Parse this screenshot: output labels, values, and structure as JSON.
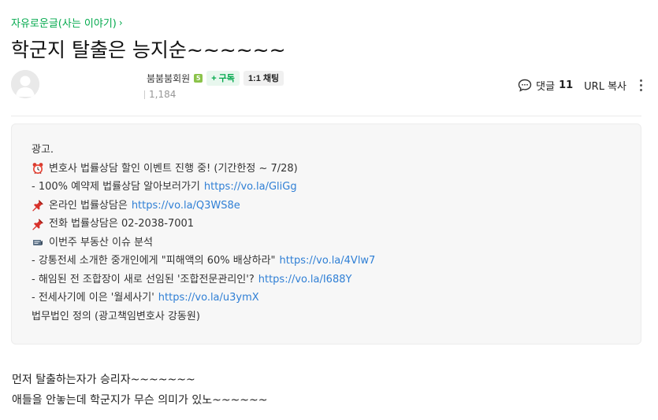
{
  "post": {
    "category": "자유로운글(사는 이야기)",
    "title": "학군지 탈출은 능지순~~~~~~",
    "author": {
      "nickname": "붐붐붐회원",
      "level_badge": "5",
      "subscribe_label": "+ 구독",
      "chat_label": "1:1 채팅",
      "views": "1,184"
    },
    "actions": {
      "comment_label": "댓글",
      "comment_count": "11",
      "url_copy_label": "URL 복사"
    }
  },
  "ad": {
    "lines": [
      {
        "icon": "",
        "text": "광고.",
        "link": ""
      },
      {
        "icon": "alarm-clock-icon",
        "text": "변호사 법률상담 할인 이벤트 진행 중! (기간한정 ~ 7/28)",
        "link": ""
      },
      {
        "icon": "",
        "text": "- 100% 예약제 법률상담 알아보러가기",
        "link": "https://vo.la/GliGg"
      },
      {
        "icon": "pushpin-icon",
        "text": "온라인 법률상담은",
        "link": "https://vo.la/Q3WS8e"
      },
      {
        "icon": "pushpin-icon",
        "text": "전화 법률상담은 02-2038-7001",
        "link": ""
      },
      {
        "icon": "news-icon",
        "text": "이번주 부동산 이슈 분석",
        "link": ""
      },
      {
        "icon": "",
        "text": "- 강통전세 소개한 중개인에게 \"피해액의 60% 배상하라\"",
        "link": "https://vo.la/4Vlw7"
      },
      {
        "icon": "",
        "text": "- 해임된 전 조합장이 새로 선임된 '조합전문관리인'?",
        "link": "https://vo.la/I688Y"
      },
      {
        "icon": "",
        "text": "- 전세사기에 이은 '월세사기'",
        "link": "https://vo.la/u3ymX"
      },
      {
        "icon": "",
        "text": "법무법인 정의 (광고책임변호사 강동원)",
        "link": ""
      }
    ]
  },
  "content": {
    "lines": [
      "먼저 탈출하는자가 승리자~~~~~~~",
      "애들을 안놓는데 학군지가 무슨 의미가 있노~~~~~~"
    ]
  },
  "colors": {
    "accent_green": "#03a94d",
    "link_blue": "#2f7fd5",
    "ad_background": "#f7f7f7"
  }
}
